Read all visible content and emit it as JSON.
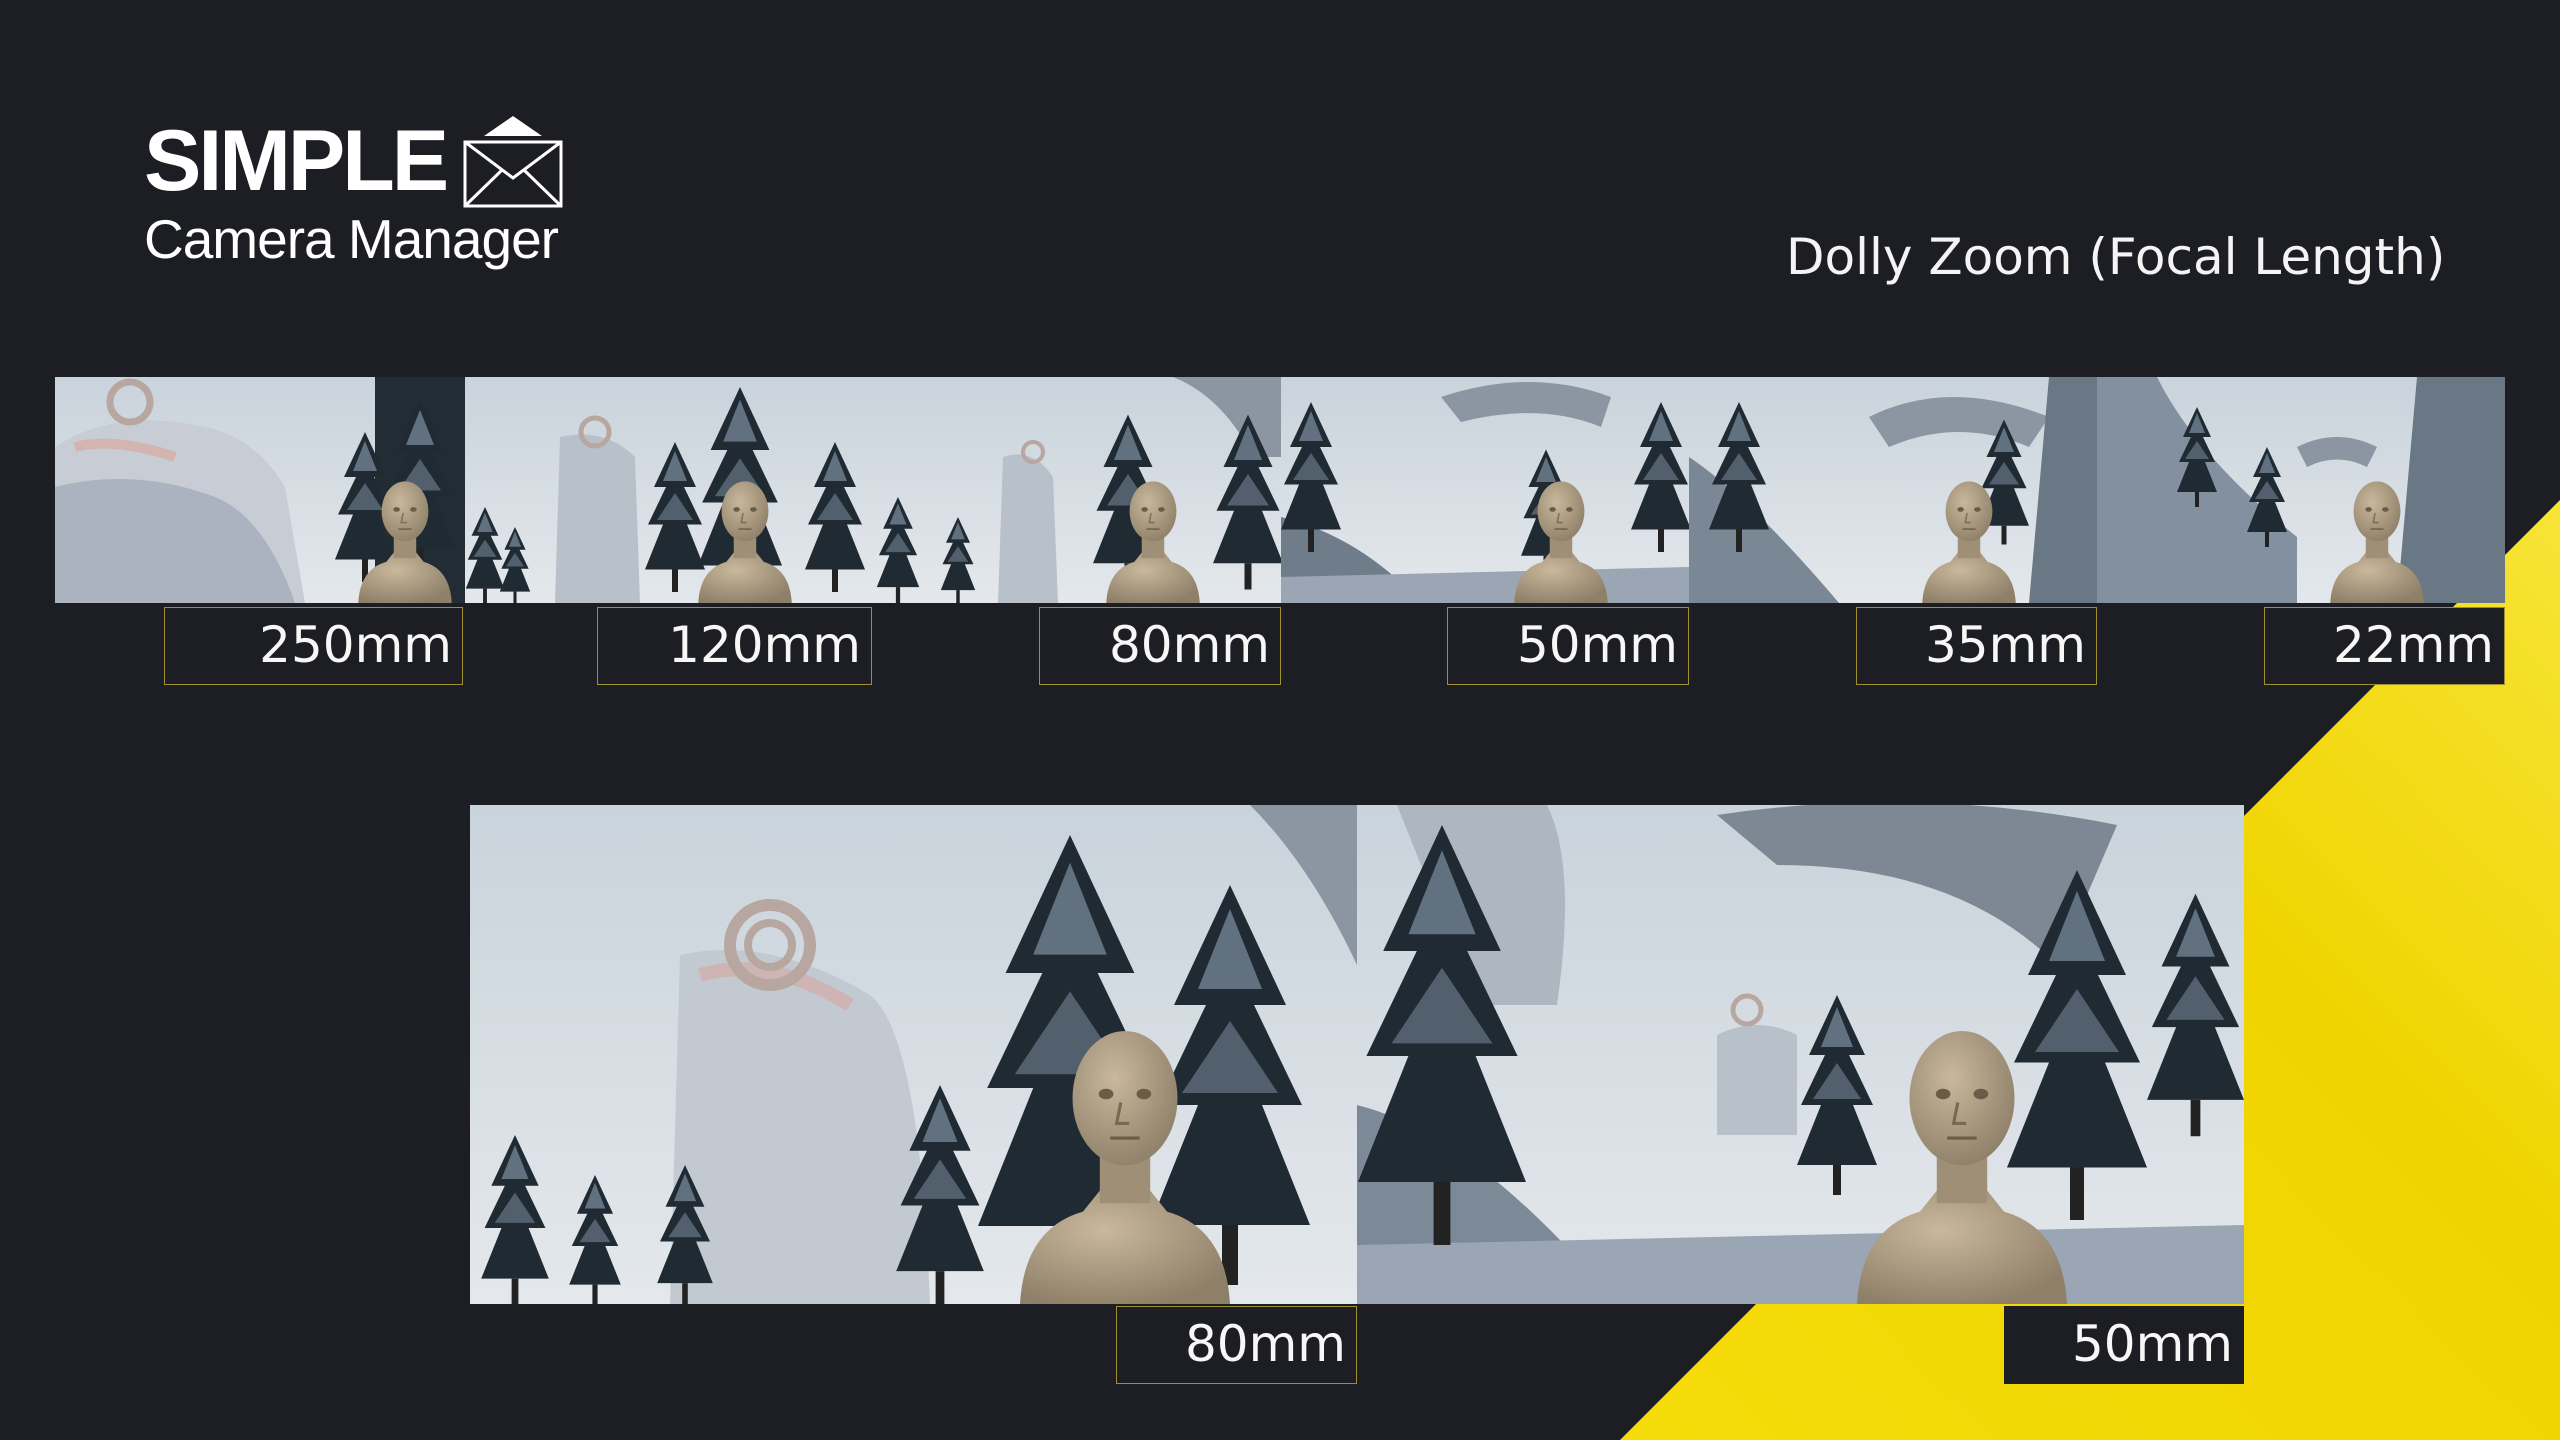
{
  "brand": {
    "title": "SIMPLE",
    "subtitle": "Camera Manager",
    "logo_icon": "envelope-roof-icon"
  },
  "heading": "Dolly Zoom (Focal Length)",
  "colors": {
    "background": "#1d1e23",
    "accent": "#f2d80c",
    "label_border": "#9e8f2f"
  },
  "thumbnails": [
    {
      "label": "250mm"
    },
    {
      "label": "120mm"
    },
    {
      "label": "80mm"
    },
    {
      "label": "50mm"
    },
    {
      "label": "35mm"
    },
    {
      "label": "22mm"
    }
  ],
  "comparison": [
    {
      "label": "80mm"
    },
    {
      "label": "50mm"
    }
  ]
}
